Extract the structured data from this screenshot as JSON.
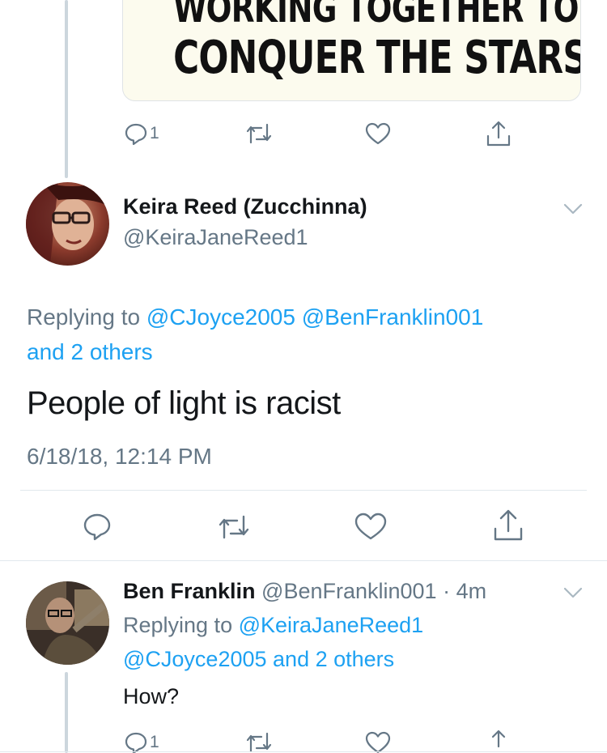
{
  "media": {
    "line1": "WORKING TOGETHER TO",
    "line2": "CONQUER THE STARS"
  },
  "top_tweet_actions": {
    "reply_count": "1"
  },
  "main_tweet": {
    "name": "Keira Reed (Zucchinna)",
    "handle": "@KeiraJaneReed1",
    "replying_prefix": "Replying to",
    "replying_mention1": "@CJoyce2005",
    "replying_mention2": "@BenFranklin001",
    "replying_others": "and 2 others",
    "text": "People of light is racist",
    "timestamp": "6/18/18, 12:14 PM"
  },
  "reply_tweet": {
    "name": "Ben Franklin",
    "handle": "@BenFranklin001",
    "time": "· 4m",
    "replying_prefix": "Replying to",
    "replying_mention1": "@KeiraJaneReed1",
    "replying_mention2": "@CJoyce2005",
    "replying_others": "and 2 others",
    "text": "How?",
    "reply_count": "1"
  },
  "colors": {
    "link": "#1da1f2",
    "secondary_text": "#657786",
    "primary_text": "#14171a",
    "thread_line": "#ccd6dd"
  }
}
